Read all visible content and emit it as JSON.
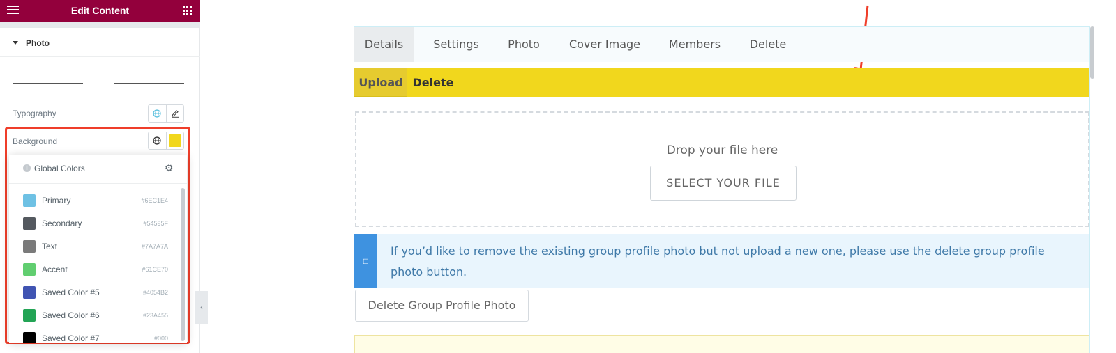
{
  "editor": {
    "title": "Edit Content",
    "section_label": "Photo",
    "typography_label": "Typography",
    "background_label": "Background",
    "background_value": "#f1d71d",
    "global_colors_title": "Global Colors",
    "colors": [
      {
        "name": "Primary",
        "hex": "#6EC1E4",
        "swatch": "#6EC1E4"
      },
      {
        "name": "Secondary",
        "hex": "#54595F",
        "swatch": "#54595F"
      },
      {
        "name": "Text",
        "hex": "#7A7A7A",
        "swatch": "#7A7A7A"
      },
      {
        "name": "Accent",
        "hex": "#61CE70",
        "swatch": "#61CE70"
      },
      {
        "name": "Saved Color #5",
        "hex": "#4054B2",
        "swatch": "#4054B2"
      },
      {
        "name": "Saved Color #6",
        "hex": "#23A455",
        "swatch": "#23A455"
      },
      {
        "name": "Saved Color #7",
        "hex": "#000",
        "swatch": "#000000"
      }
    ]
  },
  "preview": {
    "tabs": [
      "Details",
      "Settings",
      "Photo",
      "Cover Image",
      "Members",
      "Delete"
    ],
    "subtabs": [
      "Upload",
      "Delete"
    ],
    "drop_hint": "Drop your file here",
    "select_button": "SELECT YOUR FILE",
    "notice_icon": "□",
    "notice": "If you’d like to remove the existing group profile photo but not upload a new one, please use the delete group profile photo button.",
    "delete_button": "Delete Group Profile Photo"
  },
  "icons": {
    "menu": "hamburger-icon",
    "apps": "grid-icon",
    "globe": "globe-icon",
    "edit": "pencil-icon",
    "settings": "gear-icon",
    "info": "info-icon",
    "collapse": "chevron-left-icon"
  },
  "colors": {
    "brand": "#93003c",
    "highlight": "#ef3e2a",
    "subbar": "#f1d71d",
    "notice_accent": "#3e92e0"
  }
}
